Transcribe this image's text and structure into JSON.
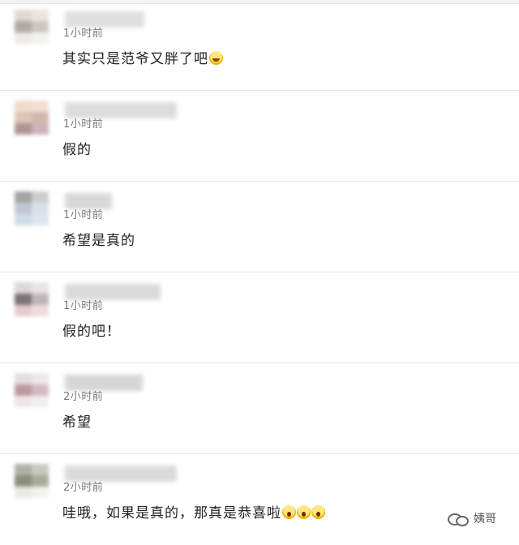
{
  "comments": [
    {
      "time": "1小时前",
      "text": "其实只是范爷又胖了吧",
      "emoji": [
        "laughing-face"
      ]
    },
    {
      "time": "1小时前",
      "text": "假的",
      "emoji": []
    },
    {
      "time": "1小时前",
      "text": "希望是真的",
      "emoji": []
    },
    {
      "time": "1小时前",
      "text": "假的吧！",
      "emoji": []
    },
    {
      "time": "2小时前",
      "text": "希望",
      "emoji": []
    },
    {
      "time": "2小时前",
      "text": "哇哦，如果是真的，那真是恭喜啦",
      "emoji": [
        "shocked-face",
        "shocked-face",
        "shocked-face"
      ]
    }
  ],
  "watermark": {
    "label": "姨哥"
  },
  "colors": {
    "divider": "#e7e7e7",
    "time_text": "#7a7a7a",
    "body_text": "#222222"
  }
}
